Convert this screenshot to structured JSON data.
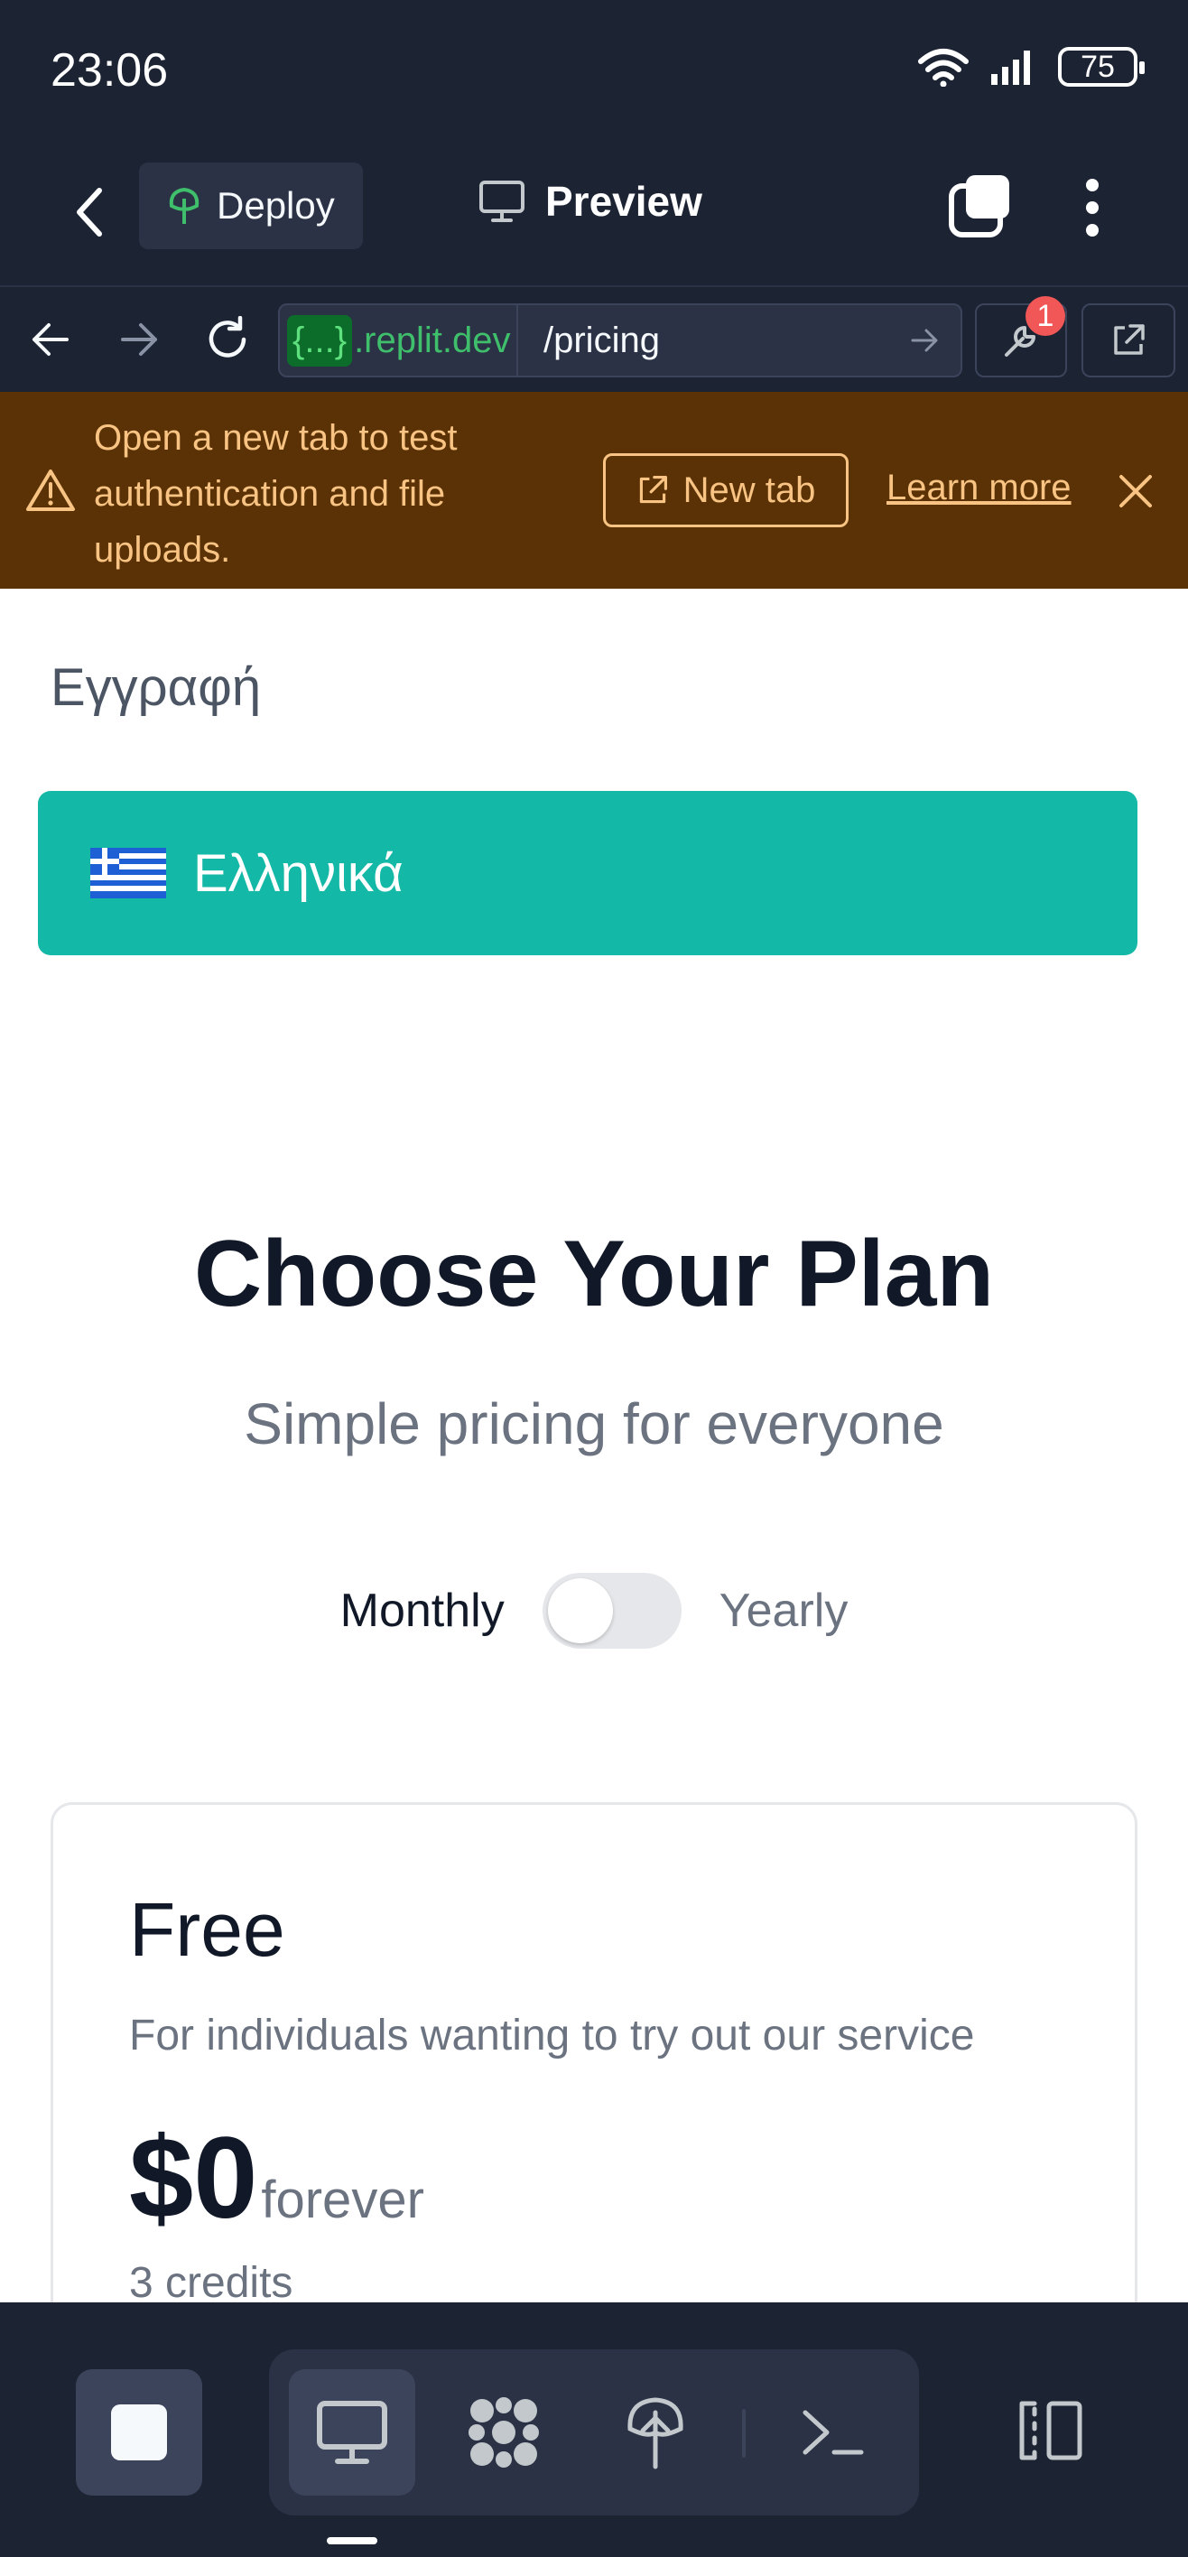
{
  "status_bar": {
    "time": "23:06",
    "battery": "75"
  },
  "header": {
    "deploy_label": "Deploy",
    "title": "Preview"
  },
  "browser": {
    "url_host_code": "{...}",
    "url_host": ".replit.dev",
    "url_path": "/pricing",
    "badge_count": "1"
  },
  "banner": {
    "message": "Open a new tab to test authentication and file uploads.",
    "new_tab_label": "New tab",
    "learn_more_label": "Learn more"
  },
  "page": {
    "signup_link": "Εγγραφή",
    "language_label": "Ελληνικά",
    "title": "Choose Your Plan",
    "subtitle": "Simple pricing for everyone",
    "billing_monthly": "Monthly",
    "billing_yearly": "Yearly",
    "plans": [
      {
        "name": "Free",
        "description": "For individuals wanting to try out our service",
        "price": "$0",
        "period": "forever",
        "credits": "3 credits"
      }
    ]
  },
  "colors": {
    "accent": "#14b8a6",
    "banner_bg": "#5a3205",
    "banner_text": "#f9c483",
    "chrome_bg": "#1c2333"
  }
}
